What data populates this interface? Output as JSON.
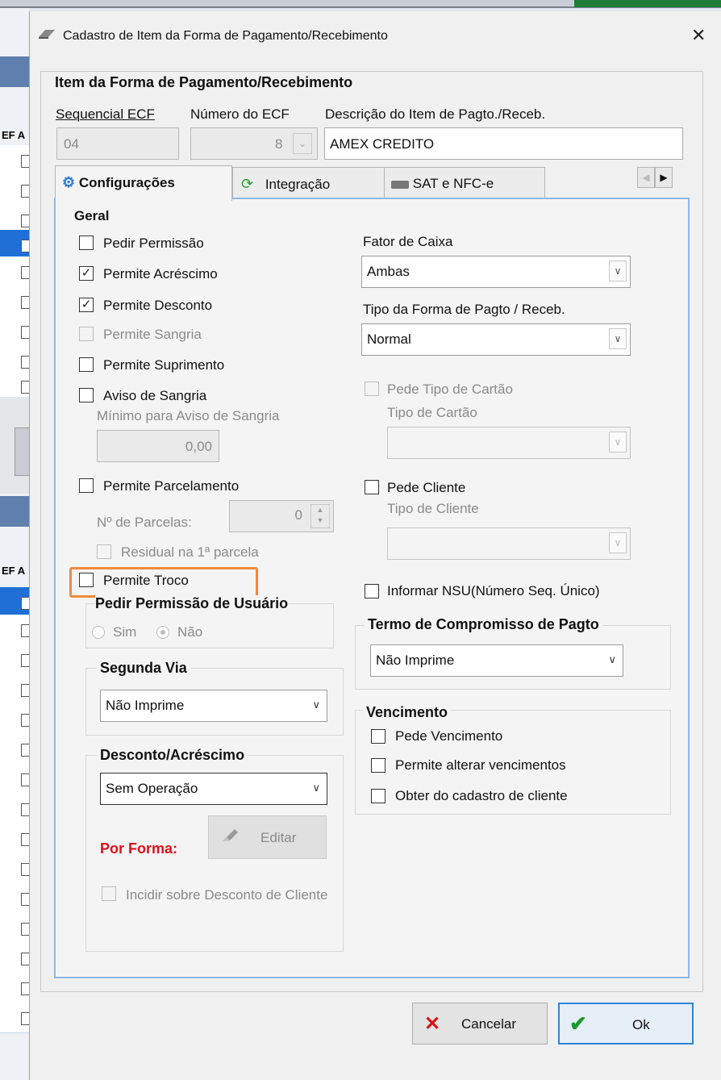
{
  "background": {
    "row_labels": [
      "EF A",
      "EF A"
    ]
  },
  "dialog": {
    "title": "Cadastro de Item da Forma de Pagamento/Recebimento",
    "close_glyph": "✕",
    "section_title": "Item da Forma de Pagamento/Recebimento",
    "sequencial_label": "Sequencial ECF",
    "sequencial_value": "04",
    "numero_label": "Número do ECF",
    "numero_value": "8",
    "descricao_label": "Descrição do Item de Pagto./Receb.",
    "descricao_value": "AMEX CREDITO"
  },
  "tabs": [
    {
      "label": "Configurações",
      "icon": "gear-icon"
    },
    {
      "label": "Integração",
      "icon": "sync-icon"
    },
    {
      "label": "SAT e NFC-e",
      "icon": "printer-icon"
    }
  ],
  "geral": {
    "title": "Geral",
    "pedir_permissao": "Pedir Permissão",
    "permite_acrescimo": "Permite Acréscimo",
    "permite_desconto": "Permite Desconto",
    "permite_sangria": "Permite Sangria",
    "permite_suprimento": "Permite Suprimento",
    "aviso_sangria": "Aviso de Sangria",
    "minimo_aviso_label": "Mínimo para Aviso de Sangria",
    "minimo_aviso_value": "0,00",
    "permite_parcelamento": "Permite Parcelamento",
    "n_parcelas_label": "Nº de Parcelas:",
    "n_parcelas_value": "0",
    "residual": "Residual na 1ª parcela",
    "permite_troco": "Permite Troco",
    "pedir_permissao_usuario": "Pedir Permissão de Usuário",
    "sim": "Sim",
    "nao": "Não",
    "checked_mark": "✓"
  },
  "segunda_via": {
    "title": "Segunda Via",
    "value": "Não Imprime"
  },
  "desconto_acrescimo": {
    "title": "Desconto/Acréscimo",
    "value": "Sem Operação",
    "por_forma": "Por Forma:",
    "editar": "Editar",
    "incidir": "Incidir sobre Desconto de Cliente"
  },
  "right": {
    "fator_caixa_label": "Fator de Caixa",
    "fator_caixa_value": "Ambas",
    "tipo_forma_label": "Tipo da Forma de Pagto / Receb.",
    "tipo_forma_value": "Normal",
    "pede_tipo_cartao": "Pede Tipo de Cartão",
    "tipo_cartao_label": "Tipo de Cartão",
    "pede_cliente": "Pede Cliente",
    "tipo_cliente_label": "Tipo de Cliente",
    "informar_nsu": "Informar NSU(Número Seq. Único)"
  },
  "termo": {
    "title": "Termo de Compromisso de Pagto",
    "value": "Não Imprime"
  },
  "vencimento": {
    "title": "Vencimento",
    "pede_vencimento": "Pede Vencimento",
    "permite_alterar": "Permite alterar vencimentos",
    "obter_cadastro": "Obter do cadastro de cliente"
  },
  "buttons": {
    "cancelar": "Cancelar",
    "ok": "Ok"
  },
  "colors": {
    "accent": "#2c86d8",
    "highlight": "#f08a3c",
    "red_label": "#e0101a",
    "ok_check": "#1a9a2a",
    "cancel_x": "#d51515"
  }
}
